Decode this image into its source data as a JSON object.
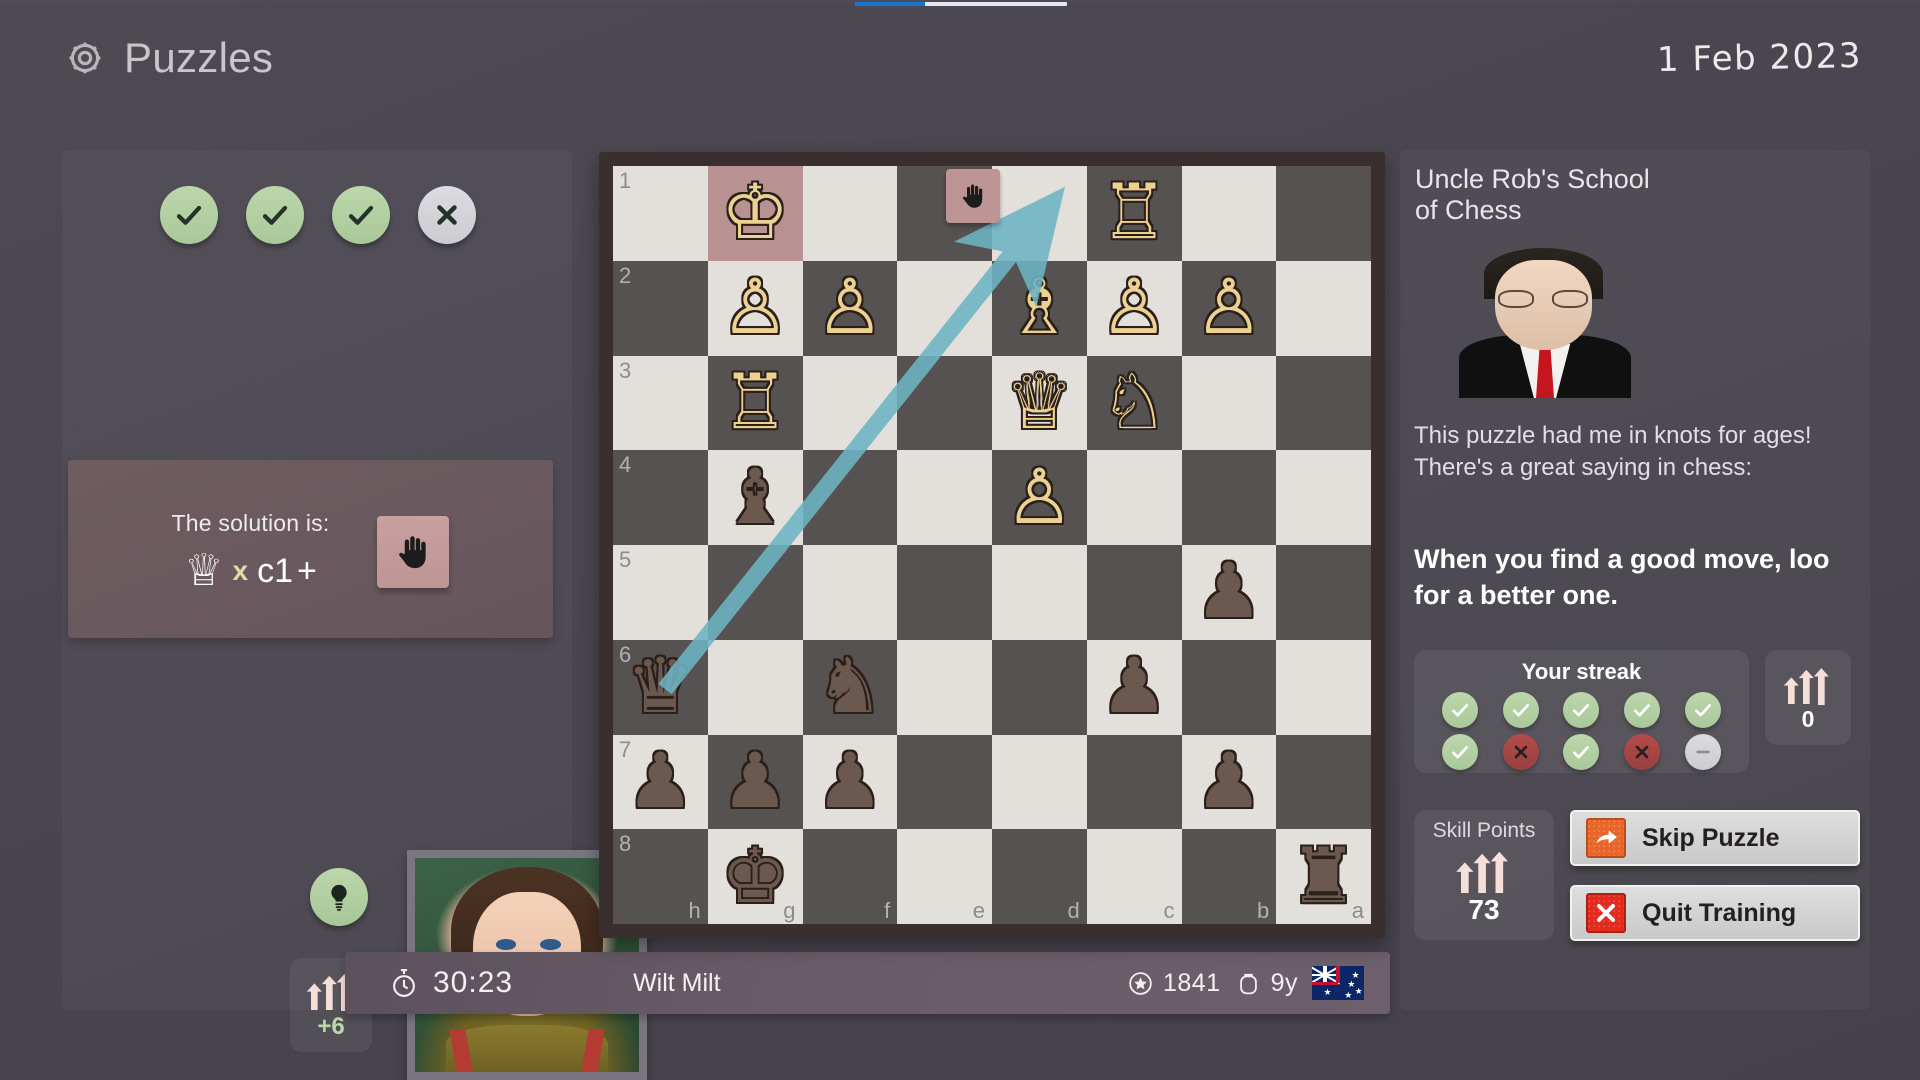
{
  "header": {
    "title": "Puzzles",
    "gear_icon": "gear-icon",
    "date": "1 Feb 2023"
  },
  "top_progress": {
    "percent": 33
  },
  "left": {
    "results": [
      {
        "state": "ok",
        "icon": "check-icon"
      },
      {
        "state": "ok",
        "icon": "check-icon"
      },
      {
        "state": "ok",
        "icon": "check-icon"
      },
      {
        "state": "fail",
        "icon": "cross-icon"
      }
    ],
    "solution": {
      "label": "The solution is:",
      "piece_glyph": "♕",
      "capture": "x",
      "square": "c1",
      "check": "+",
      "hand_icon": "hand-icon"
    },
    "hint_button": {
      "icon": "lightbulb-icon"
    },
    "skill_delta": {
      "icon": "rising-arrows-icon",
      "value": "+6"
    },
    "avatar": {
      "name": "player-avatar"
    }
  },
  "status": {
    "timer_icon": "stopwatch-icon",
    "time": "30:23",
    "player_name": "Wilt Milt",
    "rating_icon": "star-badge-icon",
    "rating": "1841",
    "age_icon": "age-icon",
    "age": "9y",
    "flag": "flag-australia"
  },
  "board": {
    "orientation": "black-at-top-left",
    "rank_labels": [
      "1",
      "2",
      "3",
      "4",
      "5",
      "6",
      "7",
      "8"
    ],
    "file_labels": [
      "h",
      "g",
      "f",
      "e",
      "d",
      "c",
      "b",
      "a"
    ],
    "light_square_color": "#e3e0db",
    "dark_square_color": "#565252",
    "highlight_square_color": "#b89292",
    "arrow_color": "#6eb4c4",
    "highlighted_squares": [
      "g1"
    ],
    "hand_marker_square": "d1",
    "arrow": {
      "from": "h6",
      "to": "c1"
    },
    "rows": [
      [
        {
          "sq": "h1",
          "shade": "light",
          "piece": null
        },
        {
          "sq": "g1",
          "shade": "hl",
          "piece": {
            "color": "w",
            "type": "king",
            "glyph": "♔"
          }
        },
        {
          "sq": "f1",
          "shade": "light",
          "piece": null
        },
        {
          "sq": "e1",
          "shade": "dark",
          "piece": null
        },
        {
          "sq": "d1",
          "shade": "light",
          "piece": null
        },
        {
          "sq": "c1",
          "shade": "dark",
          "piece": {
            "color": "w",
            "type": "rook",
            "glyph": "♖"
          }
        },
        {
          "sq": "b1",
          "shade": "light",
          "piece": null
        },
        {
          "sq": "a1",
          "shade": "dark",
          "piece": null
        }
      ],
      [
        {
          "sq": "h2",
          "shade": "dark",
          "piece": null
        },
        {
          "sq": "g2",
          "shade": "light",
          "piece": {
            "color": "w",
            "type": "pawn",
            "glyph": "♙"
          }
        },
        {
          "sq": "f2",
          "shade": "dark",
          "piece": {
            "color": "w",
            "type": "pawn",
            "glyph": "♙"
          }
        },
        {
          "sq": "e2",
          "shade": "light",
          "piece": null
        },
        {
          "sq": "d2",
          "shade": "dark",
          "piece": {
            "color": "w",
            "type": "bishop",
            "glyph": "♗"
          }
        },
        {
          "sq": "c2",
          "shade": "light",
          "piece": {
            "color": "w",
            "type": "pawn",
            "glyph": "♙"
          }
        },
        {
          "sq": "b2",
          "shade": "dark",
          "piece": {
            "color": "w",
            "type": "pawn",
            "glyph": "♙"
          }
        },
        {
          "sq": "a2",
          "shade": "light",
          "piece": null
        }
      ],
      [
        {
          "sq": "h3",
          "shade": "light",
          "piece": null
        },
        {
          "sq": "g3",
          "shade": "dark",
          "piece": {
            "color": "w",
            "type": "rook",
            "glyph": "♖"
          }
        },
        {
          "sq": "f3",
          "shade": "light",
          "piece": null
        },
        {
          "sq": "e3",
          "shade": "dark",
          "piece": null
        },
        {
          "sq": "d3",
          "shade": "light",
          "piece": {
            "color": "w",
            "type": "queen",
            "glyph": "♕"
          }
        },
        {
          "sq": "c3",
          "shade": "dark",
          "piece": {
            "color": "w",
            "type": "knight",
            "glyph": "♘"
          }
        },
        {
          "sq": "b3",
          "shade": "light",
          "piece": null
        },
        {
          "sq": "a3",
          "shade": "dark",
          "piece": null
        }
      ],
      [
        {
          "sq": "h4",
          "shade": "dark",
          "piece": null
        },
        {
          "sq": "g4",
          "shade": "light",
          "piece": {
            "color": "b",
            "type": "bishop",
            "glyph": "♝"
          }
        },
        {
          "sq": "f4",
          "shade": "dark",
          "piece": null
        },
        {
          "sq": "e4",
          "shade": "light",
          "piece": null
        },
        {
          "sq": "d4",
          "shade": "dark",
          "piece": {
            "color": "w",
            "type": "pawn",
            "glyph": "♙"
          }
        },
        {
          "sq": "c4",
          "shade": "light",
          "piece": null
        },
        {
          "sq": "b4",
          "shade": "dark",
          "piece": null
        },
        {
          "sq": "a4",
          "shade": "light",
          "piece": null
        }
      ],
      [
        {
          "sq": "h5",
          "shade": "light",
          "piece": null
        },
        {
          "sq": "g5",
          "shade": "dark",
          "piece": null
        },
        {
          "sq": "f5",
          "shade": "light",
          "piece": null
        },
        {
          "sq": "e5",
          "shade": "dark",
          "piece": null
        },
        {
          "sq": "d5",
          "shade": "light",
          "piece": null
        },
        {
          "sq": "c5",
          "shade": "dark",
          "piece": null
        },
        {
          "sq": "b5",
          "shade": "light",
          "piece": {
            "color": "b",
            "type": "pawn",
            "glyph": "♟"
          }
        },
        {
          "sq": "a5",
          "shade": "dark",
          "piece": null
        }
      ],
      [
        {
          "sq": "h6",
          "shade": "dark",
          "piece": {
            "color": "b",
            "type": "queen",
            "glyph": "♛"
          }
        },
        {
          "sq": "g6",
          "shade": "light",
          "piece": null
        },
        {
          "sq": "f6",
          "shade": "dark",
          "piece": {
            "color": "b",
            "type": "knight",
            "glyph": "♞"
          }
        },
        {
          "sq": "e6",
          "shade": "light",
          "piece": null
        },
        {
          "sq": "d6",
          "shade": "dark",
          "piece": null
        },
        {
          "sq": "c6",
          "shade": "light",
          "piece": {
            "color": "b",
            "type": "pawn",
            "glyph": "♟"
          }
        },
        {
          "sq": "b6",
          "shade": "dark",
          "piece": null
        },
        {
          "sq": "a6",
          "shade": "light",
          "piece": null
        }
      ],
      [
        {
          "sq": "h7",
          "shade": "light",
          "piece": {
            "color": "b",
            "type": "pawn",
            "glyph": "♟"
          }
        },
        {
          "sq": "g7",
          "shade": "dark",
          "piece": {
            "color": "b",
            "type": "pawn",
            "glyph": "♟"
          }
        },
        {
          "sq": "f7",
          "shade": "light",
          "piece": {
            "color": "b",
            "type": "pawn",
            "glyph": "♟"
          }
        },
        {
          "sq": "e7",
          "shade": "dark",
          "piece": null
        },
        {
          "sq": "d7",
          "shade": "light",
          "piece": null
        },
        {
          "sq": "c7",
          "shade": "dark",
          "piece": null
        },
        {
          "sq": "b7",
          "shade": "light",
          "piece": {
            "color": "b",
            "type": "pawn",
            "glyph": "♟"
          }
        },
        {
          "sq": "a7",
          "shade": "dark",
          "piece": null
        }
      ],
      [
        {
          "sq": "h8",
          "shade": "dark",
          "piece": null
        },
        {
          "sq": "g8",
          "shade": "light",
          "piece": {
            "color": "b",
            "type": "king",
            "glyph": "♚"
          }
        },
        {
          "sq": "f8",
          "shade": "dark",
          "piece": null
        },
        {
          "sq": "e8",
          "shade": "light",
          "piece": null
        },
        {
          "sq": "d8",
          "shade": "dark",
          "piece": null
        },
        {
          "sq": "c8",
          "shade": "light",
          "piece": null
        },
        {
          "sq": "b8",
          "shade": "dark",
          "piece": null
        },
        {
          "sq": "a8",
          "shade": "light",
          "piece": {
            "color": "b",
            "type": "rook",
            "glyph": "♜"
          }
        }
      ]
    ]
  },
  "right": {
    "coach_title": "Uncle Rob's School\nof Chess",
    "coach_intro": "This puzzle had me in knots for ages!\nThere's a great saying in chess:",
    "coach_quote": "When you find a good move, loo for a better one.",
    "streak": {
      "title": "Your streak",
      "cells": [
        {
          "state": "ok",
          "icon": "check-icon"
        },
        {
          "state": "ok",
          "icon": "check-icon"
        },
        {
          "state": "ok",
          "icon": "check-icon"
        },
        {
          "state": "ok",
          "icon": "check-icon"
        },
        {
          "state": "ok",
          "icon": "check-icon"
        },
        {
          "state": "ok",
          "icon": "check-icon"
        },
        {
          "state": "bad",
          "icon": "cross-icon"
        },
        {
          "state": "ok",
          "icon": "check-icon"
        },
        {
          "state": "bad",
          "icon": "cross-icon"
        },
        {
          "state": "none",
          "icon": "dash-icon"
        }
      ]
    },
    "streak_counter": {
      "icon": "rising-arrows-icon",
      "value": "0"
    },
    "skill_points": {
      "label": "Skill Points",
      "icon": "rising-arrows-icon",
      "value": "73"
    },
    "buttons": [
      {
        "label": "Skip Puzzle",
        "icon": "skip-arrow-icon"
      },
      {
        "label": "Quit Training",
        "icon": "cross-icon"
      }
    ]
  }
}
